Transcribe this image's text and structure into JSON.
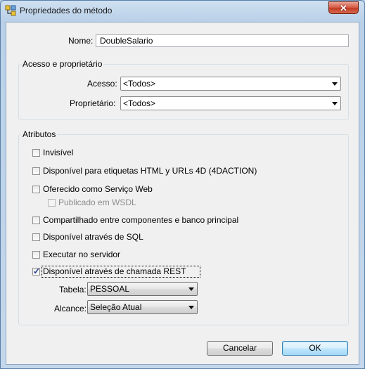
{
  "window": {
    "title": "Propriedades do método",
    "app_icon": "app-icon",
    "close_icon": "close-icon"
  },
  "name_field": {
    "label": "Nome:",
    "value": "DoubleSalario"
  },
  "access_group": {
    "title": "Acesso e proprietário",
    "access_label": "Acesso:",
    "access_value": "<Todos>",
    "owner_label": "Proprietário:",
    "owner_value": "<Todos>"
  },
  "attributes_group": {
    "title": "Atributos",
    "invisible": {
      "label": "Invisível",
      "checked": false
    },
    "html_tags": {
      "label": "Disponível para etiquetas HTML y URLs 4D (4DACTION)",
      "checked": false
    },
    "web_service": {
      "label": "Oferecido como Serviço Web",
      "checked": false
    },
    "wsdl": {
      "label": "Publicado em WSDL",
      "checked": false,
      "enabled": false
    },
    "shared": {
      "label": "Compartilhado entre componentes e banco principal",
      "checked": false
    },
    "sql": {
      "label": "Disponível através de SQL",
      "checked": false
    },
    "server": {
      "label": "Executar no servidor",
      "checked": false
    },
    "rest": {
      "label": "Disponível através de chamada REST",
      "checked": true
    },
    "table_label": "Tabela:",
    "table_value": "PESSOAL",
    "scope_label": "Alcance:",
    "scope_value": "Seleção Atual"
  },
  "buttons": {
    "cancel": "Cancelar",
    "ok": "OK"
  }
}
